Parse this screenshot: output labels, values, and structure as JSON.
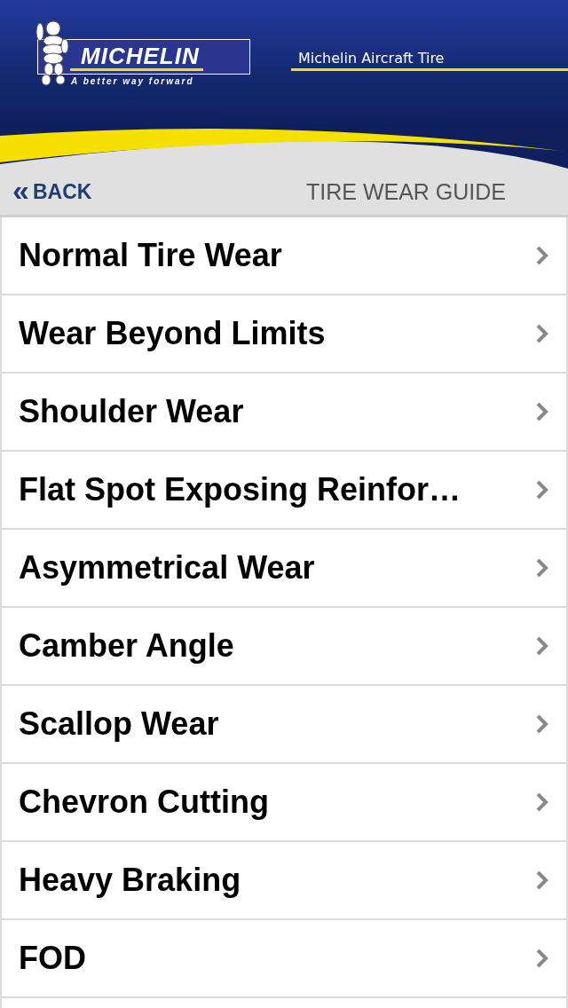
{
  "brand": {
    "wordmark": "MICHELIN",
    "tagline": "A better way forward",
    "product": "Michelin Aircraft Tire"
  },
  "nav": {
    "back": "BACK",
    "back_glyph": "«",
    "title": "TIRE WEAR GUIDE"
  },
  "items": [
    {
      "label": "Normal Tire Wear"
    },
    {
      "label": "Wear Beyond Limits"
    },
    {
      "label": "Shoulder Wear"
    },
    {
      "label": "Flat Spot Exposing Reinfor…"
    },
    {
      "label": "Asymmetrical Wear"
    },
    {
      "label": "Camber Angle"
    },
    {
      "label": "Scallop Wear"
    },
    {
      "label": "Chevron Cutting"
    },
    {
      "label": "Heavy Braking"
    },
    {
      "label": "FOD"
    }
  ]
}
